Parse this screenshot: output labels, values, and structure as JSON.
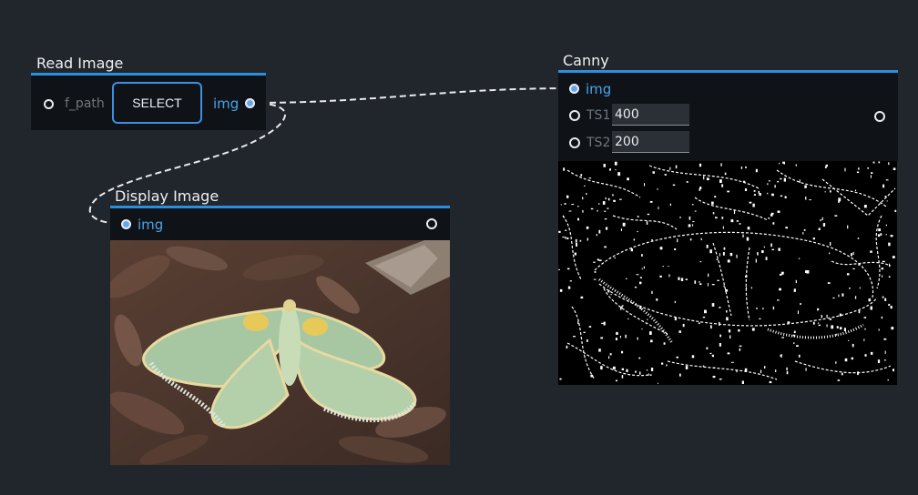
{
  "nodes": {
    "read_image": {
      "title": "Read Image",
      "input_label": "f_path",
      "button_label": "SELECT",
      "output_label": "img"
    },
    "display_image": {
      "title": "Display Image",
      "input_label": "img"
    },
    "canny": {
      "title": "Canny",
      "input_img_label": "img",
      "ts1_label": "TS1",
      "ts1_value": "400",
      "ts2_label": "TS2",
      "ts2_value": "200"
    }
  },
  "colors": {
    "background": "#21252c",
    "node_body": "#0f1318",
    "accent": "#2b8fdf",
    "port_label": "#4aa3ea"
  },
  "icons": {
    "empty_port": "hollow-circle",
    "connected_port": "filled-circle"
  }
}
